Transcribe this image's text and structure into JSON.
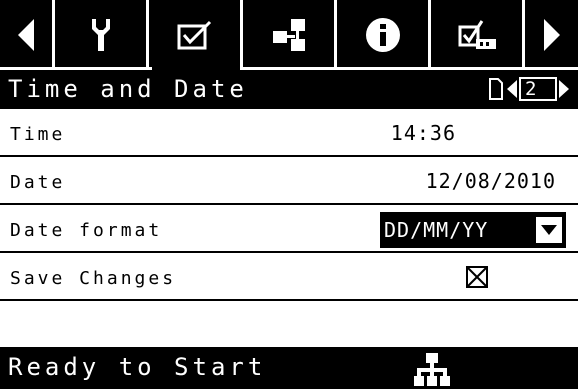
{
  "tabs": [
    {
      "icon": "arrow-left-icon"
    },
    {
      "icon": "wrench-icon"
    },
    {
      "icon": "checkbox-icon",
      "active": true
    },
    {
      "icon": "network-icon"
    },
    {
      "icon": "info-icon"
    },
    {
      "icon": "settings-checklist-icon"
    },
    {
      "icon": "arrow-right-icon"
    }
  ],
  "title": "Time and Date",
  "pager": {
    "page": "2"
  },
  "rows": {
    "time": {
      "label": "Time",
      "value": "14:36"
    },
    "date": {
      "label": "Date",
      "value": "12/08/2010"
    },
    "date_format": {
      "label": "Date format",
      "value": "DD/MM/YY"
    },
    "save_changes": {
      "label": "Save Changes",
      "checked": true
    }
  },
  "status": {
    "text": "Ready to Start",
    "icon": "network-tree-icon"
  },
  "colors": {
    "background": "#000000",
    "foreground": "#ffffff"
  }
}
